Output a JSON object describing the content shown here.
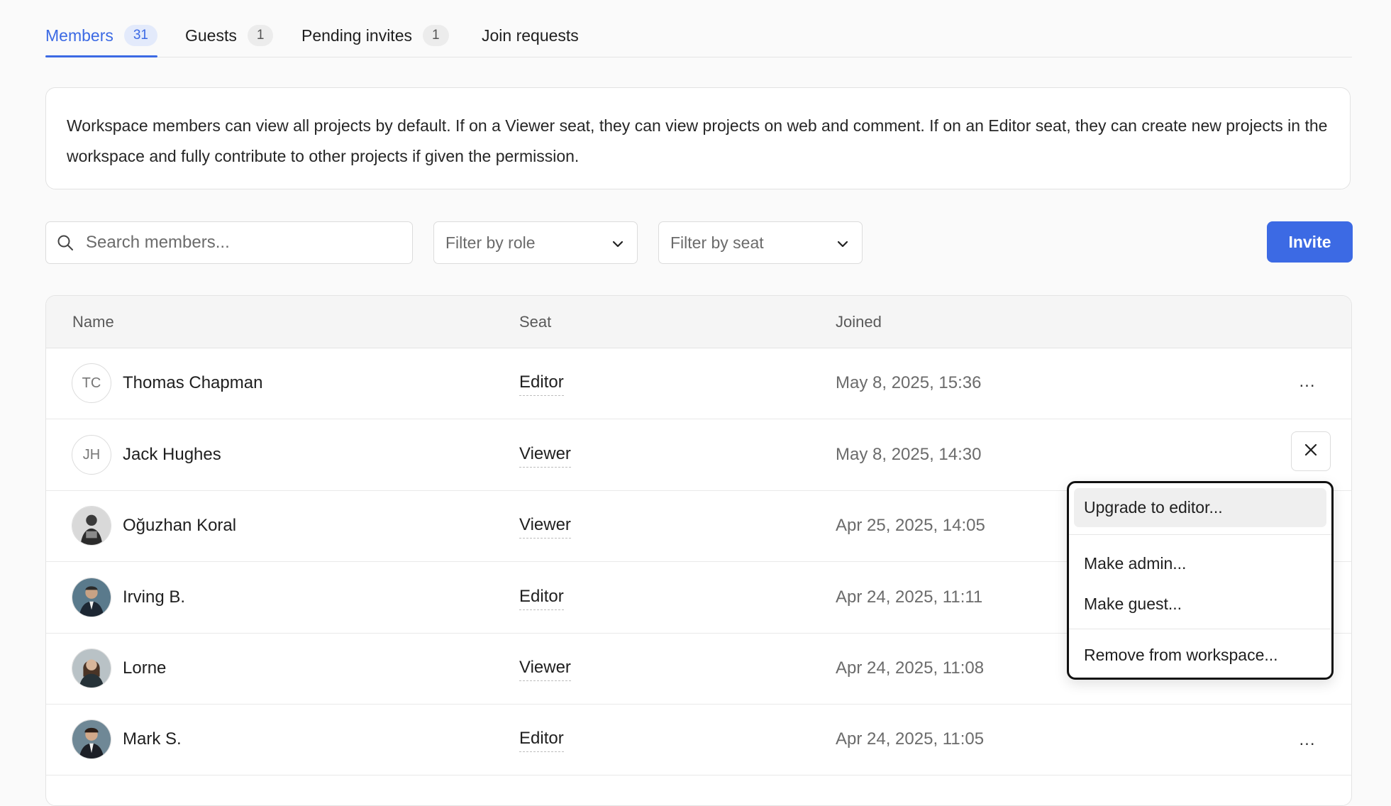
{
  "tabs": [
    {
      "label": "Members",
      "count": "31",
      "active": true
    },
    {
      "label": "Guests",
      "count": "1"
    },
    {
      "label": "Pending invites",
      "count": "1"
    },
    {
      "label": "Join requests"
    }
  ],
  "info_text": "Workspace members can view all projects by default. If on a Viewer seat, they can view projects on web and comment. If on an Editor seat, they can create new projects in the workspace and fully contribute to other projects if given the permission.",
  "toolbar": {
    "search_placeholder": "Search members...",
    "filter_role": "Filter by role",
    "filter_seat": "Filter by seat",
    "invite_label": "Invite"
  },
  "table": {
    "columns": [
      "Name",
      "Seat",
      "Joined"
    ],
    "rows": [
      {
        "initials": "TC",
        "name": "Thomas Chapman",
        "seat": "Editor",
        "joined": "May 8, 2025, 15:36",
        "action": "..."
      },
      {
        "initials": "JH",
        "name": "Jack Hughes",
        "seat": "Viewer",
        "joined": "May 8, 2025, 14:30",
        "action": "close"
      },
      {
        "name": "Oğuzhan Koral",
        "seat": "Viewer",
        "joined": "Apr 25, 2025, 14:05"
      },
      {
        "name": "Irving B.",
        "seat": "Editor",
        "joined": "Apr 24, 2025, 11:11"
      },
      {
        "name": "Lorne",
        "seat": "Viewer",
        "joined": "Apr 24, 2025, 11:08"
      },
      {
        "name": "Mark S.",
        "seat": "Editor",
        "joined": "Apr 24, 2025, 11:05",
        "action": "..."
      }
    ]
  },
  "menu": {
    "items": [
      "Upgrade to editor...",
      "Make admin...",
      "Make guest...",
      "Remove from workspace..."
    ]
  },
  "colors": {
    "accent": "#3c6ae4",
    "background": "#fafafa"
  },
  "icons": {
    "search": "search-icon",
    "chevron": "chevron-down-icon",
    "close": "close-icon",
    "more": "more-horizontal-icon"
  }
}
